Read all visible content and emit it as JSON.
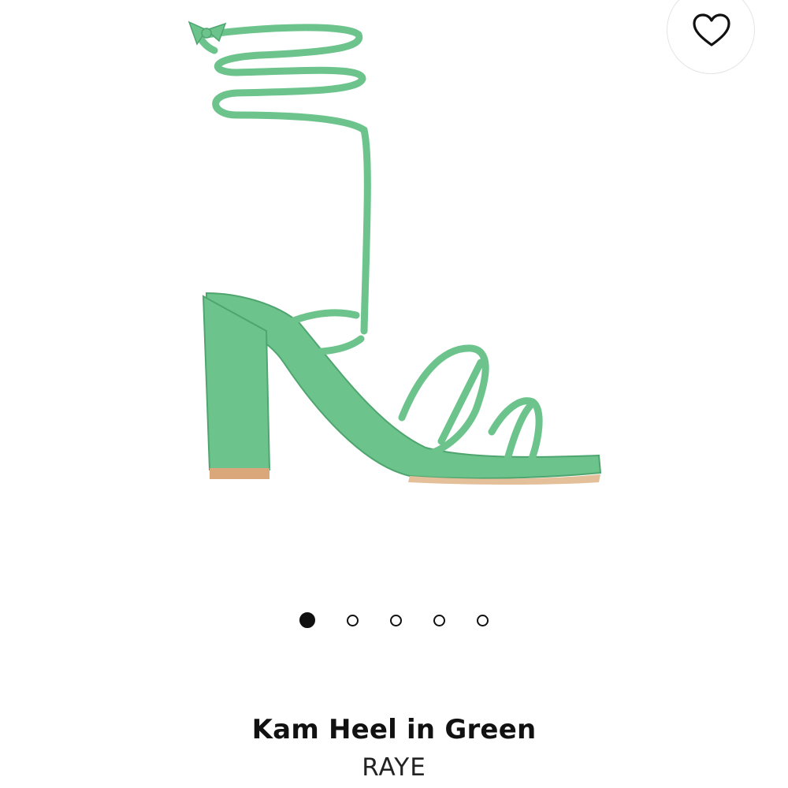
{
  "product": {
    "name": "Kam Heel in Green",
    "brand": "RAYE"
  },
  "gallery": {
    "image_count": 5,
    "active_index": 0,
    "image_alt": "Green strappy block heel sandal with ankle wrap ties"
  },
  "icons": {
    "wishlist": "heart-outline-icon"
  },
  "colors": {
    "sandal": "#6cc48c",
    "sandal_shadow": "#4fa56f",
    "sole": "#d9a77a",
    "text": "#111111"
  }
}
